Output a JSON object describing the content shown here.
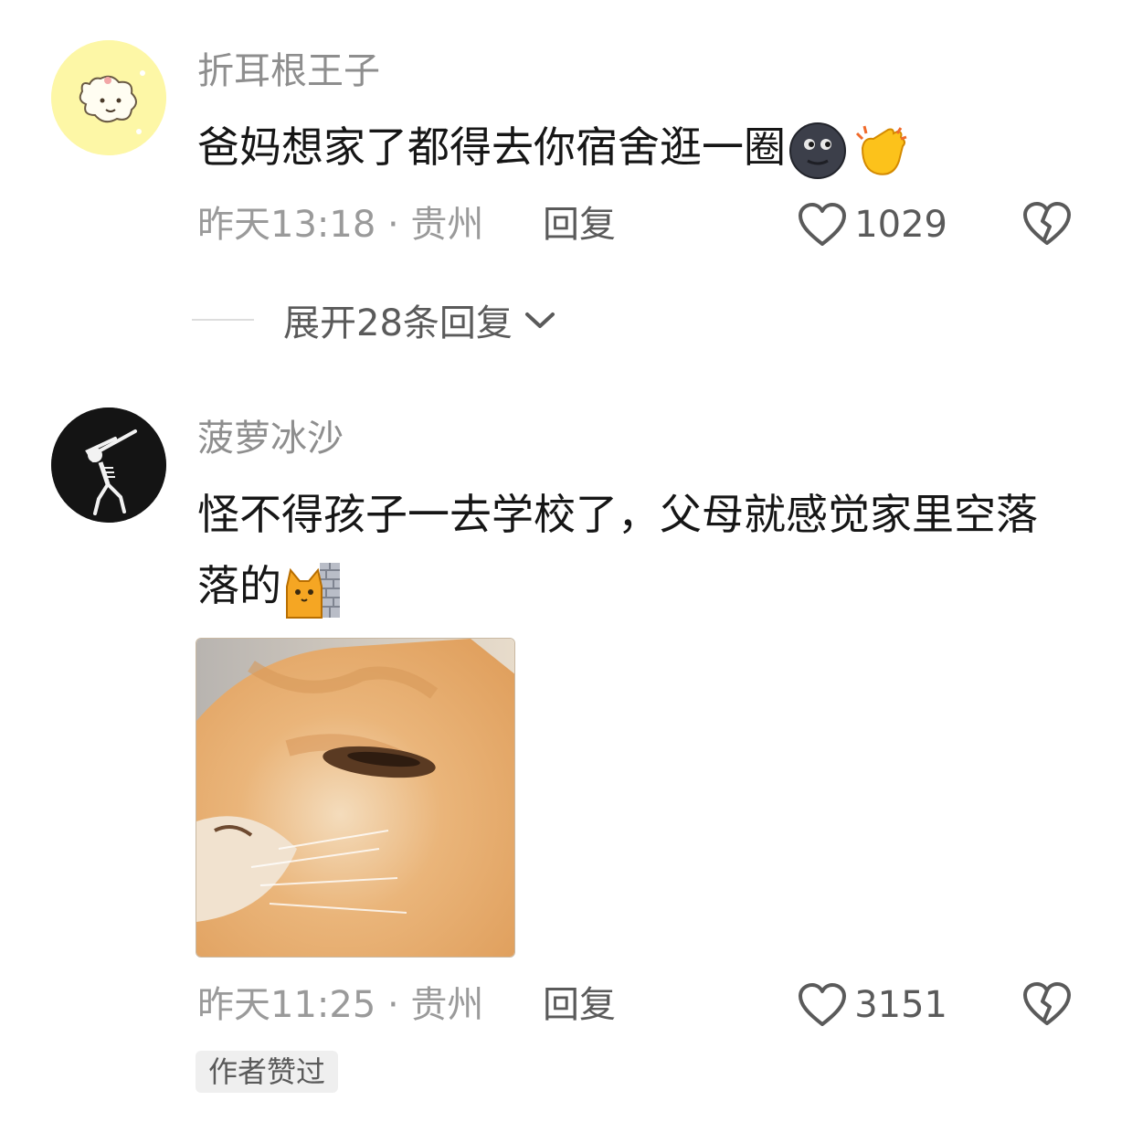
{
  "comments": [
    {
      "username": "折耳根王子",
      "text": "爸妈想家了都得去你宿舍逛一圈",
      "emojis": [
        "new-moon-face-emoji",
        "clapping-hands-emoji"
      ],
      "time_location": "昨天13:18 · 贵州",
      "reply_label": "回复",
      "likes": "1029",
      "expand_replies": "展开28条回复"
    },
    {
      "username": "菠萝冰沙",
      "text": "怪不得孩子一去学校了，父母就感觉家里空落落的",
      "emojis": [
        "cat-peeking-emoji"
      ],
      "time_location": "昨天11:25 · 贵州",
      "reply_label": "回复",
      "likes": "3151",
      "author_liked": "作者赞过"
    }
  ],
  "colors": {
    "meta_gray": "#9a9a9a",
    "username_gray": "#8e8e8e",
    "text": "#161616",
    "badge_bg": "#efefef"
  }
}
